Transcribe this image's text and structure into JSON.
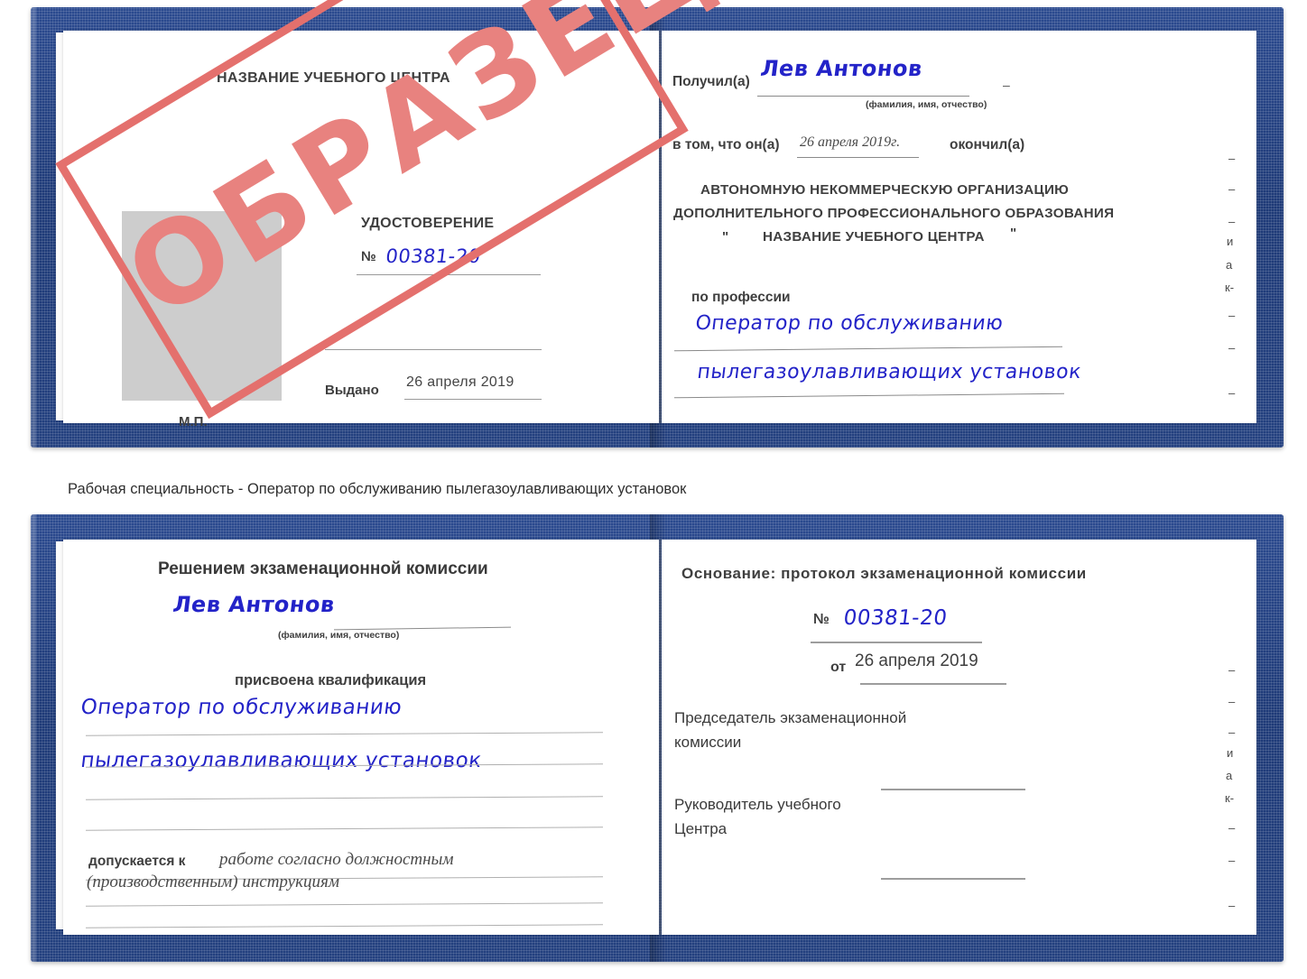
{
  "document": {
    "type": "certificate-scan",
    "caption": "Рабочая специальность - Оператор по обслуживанию пылегазоулавливающих установок"
  },
  "colors": {
    "cover_blue": "#1e3a77",
    "stamp_red": "#e4706d",
    "handwriting_blue": "#2323c8",
    "paper_white": "#ffffff",
    "photo_gray": "#cdcdcd"
  },
  "watermark": {
    "text": "ОБРАЗЕЦ"
  },
  "certificate_top": {
    "left_page": {
      "org_title": "НАЗВАНИЕ УЧЕБНОГО ЦЕНТРА",
      "doc_title": "УДОСТОВЕРЕНИЕ",
      "number_label": "№",
      "number_value": "00381-20",
      "issued_label": "Выдано",
      "issued_value": "26 апреля 2019",
      "seal_label": "М.П.",
      "photo_placeholder": "photo-placeholder"
    },
    "right_page": {
      "received_label": "Получил(а)",
      "received_value": "Лев Антонов",
      "fio_hint": "(фамилия, имя, отчество)",
      "in_that_label": "в том, что он(а)",
      "completion_date": "26 апреля 2019г.",
      "finished_label": "окончил(а)",
      "org_line1": "АВТОНОМНУЮ НЕКОММЕРЧЕСКУЮ ОРГАНИЗАЦИЮ",
      "org_line2": "ДОПОЛНИТЕЛЬНОГО ПРОФЕССИОНАЛЬНОГО ОБРАЗОВАНИЯ",
      "org_quote_open": "\"",
      "org_line3": "НАЗВАНИЕ УЧЕБНОГО ЦЕНТРА",
      "org_quote_close": "\"",
      "profession_label": "по профессии",
      "profession_line1": "Оператор по обслуживанию",
      "profession_line2": "пылегазоулавливающих установок",
      "edge_fragments": [
        "–",
        "–",
        "–",
        "и",
        "а",
        "к-",
        "–",
        "–",
        "–"
      ]
    }
  },
  "certificate_bottom": {
    "left_page": {
      "decision_title": "Решением экзаменационной комиссии",
      "name_value": "Лев Антонов",
      "fio_hint": "(фамилия, имя, отчество)",
      "qualification_label": "присвоена квалификация",
      "qualification_line1": "Оператор по обслуживанию",
      "qualification_line2": "пылегазоулавливающих установок",
      "admitted_label": "допускается к",
      "admitted_line1": "работе согласно должностным",
      "admitted_line2": "(производственным) инструкциям"
    },
    "right_page": {
      "basis_label": "Основание: протокол экзаменационной комиссии",
      "number_label": "№",
      "number_value": "00381-20",
      "date_label": "от",
      "date_value": "26 апреля 2019",
      "chairman_line1": "Председатель экзаменационной",
      "chairman_line2": "комиссии",
      "head_line1": "Руководитель учебного",
      "head_line2": "Центра",
      "edge_fragments": [
        "–",
        "–",
        "–",
        "и",
        "а",
        "к-",
        "–",
        "–",
        "–"
      ]
    }
  }
}
